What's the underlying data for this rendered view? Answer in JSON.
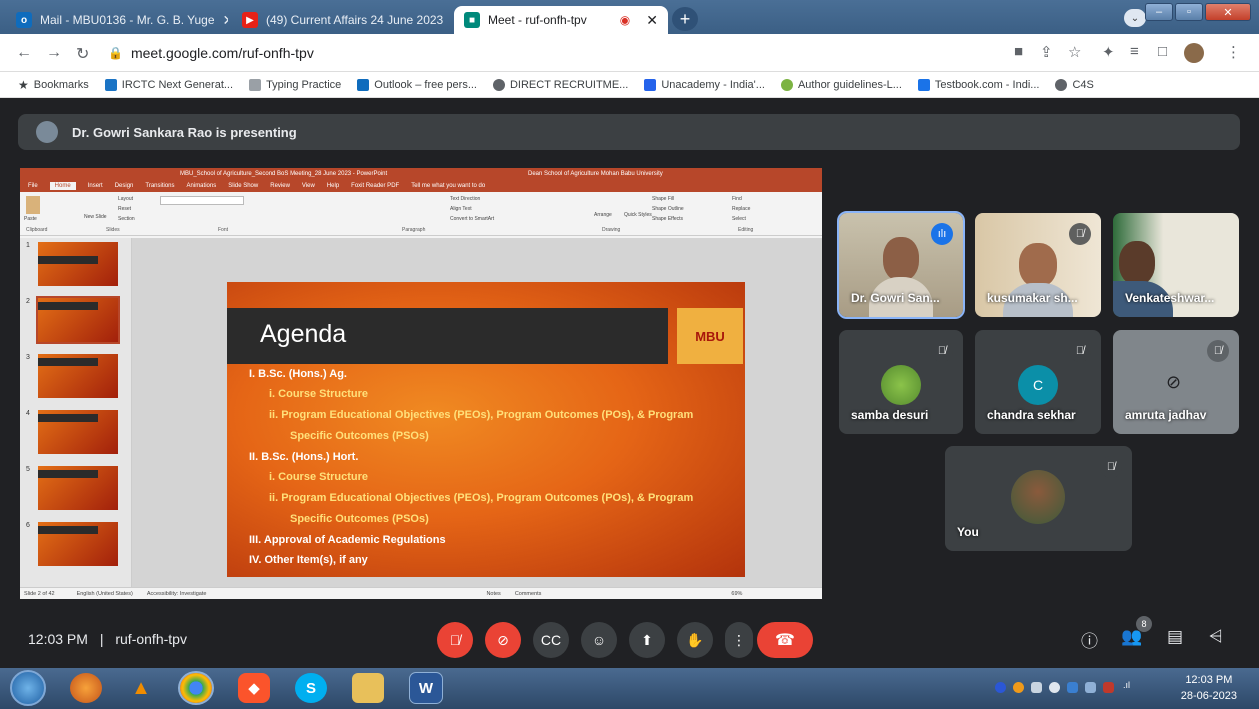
{
  "browser": {
    "tabs": [
      {
        "title": "Mail - MBU0136 - Mr. G. B. Yuge",
        "icon": "outlook-icon",
        "active": false
      },
      {
        "title": "(49) Current Affairs 24 June 2023",
        "icon": "youtube-icon",
        "active": false
      },
      {
        "title": "Meet - ruf-onfh-tpv",
        "icon": "meet-icon",
        "active": true
      }
    ],
    "new_tab_label": "+",
    "url": "meet.google.com/ruf-onfh-tpv",
    "bookmarks_label": "Bookmarks",
    "bookmarks": [
      "IRCTC Next Generat...",
      "Typing Practice",
      "Outlook – free pers...",
      "DIRECT RECRUITME...",
      "Unacademy - India'...",
      "Author guidelines-L...",
      "Testbook.com - Indi...",
      "C4S"
    ]
  },
  "meet": {
    "presenting_text": "Dr. Gowri Sankara Rao is presenting",
    "time": "12:03 PM",
    "separator": "|",
    "meeting_code": "ruf-onfh-tpv",
    "participant_count": "8",
    "participants": [
      {
        "name": "Dr. Gowri San...",
        "muted": false,
        "speaking": true
      },
      {
        "name": "kusumakar sh...",
        "muted": true
      },
      {
        "name": "Venkateshwar...",
        "muted": true
      },
      {
        "name": "samba desuri",
        "muted": true
      },
      {
        "name": "chandra sekhar",
        "muted": true,
        "initial": "C",
        "avatar_color": "#0b8fa8"
      },
      {
        "name": "amruta jadhav",
        "muted": true
      },
      {
        "name": "You",
        "muted": true
      }
    ]
  },
  "ppt": {
    "title_bar": "MBU_School of Agriculture_Second BoS Meeting_28 June 2023 - PowerPoint",
    "title_bar_right": "Dean School of Agriculture Mohan Babu University",
    "menu": [
      "File",
      "Home",
      "Insert",
      "Design",
      "Transitions",
      "Animations",
      "Slide Show",
      "Review",
      "View",
      "Help",
      "Foxit Reader PDF",
      "Tell me what you want to do"
    ],
    "groups": [
      "Clipboard",
      "Slides",
      "Font",
      "Paragraph",
      "Drawing",
      "Editing"
    ],
    "ribbon_items": {
      "paste": "Paste",
      "layout": "Layout",
      "reset": "Reset",
      "new_slide": "New Slide",
      "section": "Section",
      "text_direction": "Text Direction",
      "align_text": "Align Text",
      "convert_smartart": "Convert to SmartArt",
      "arrange": "Arrange",
      "quick_styles": "Quick Styles",
      "shape_fill": "Shape Fill",
      "shape_outline": "Shape Outline",
      "shape_effects": "Shape Effects",
      "find": "Find",
      "replace": "Replace",
      "select": "Select"
    },
    "status": "Slide 2 of 42",
    "language": "English (United States)",
    "accessibility": "Accessibility: Investigate",
    "notes": "Notes",
    "comments": "Comments",
    "zoom": "69%",
    "thumb_numbers": [
      "1",
      "2",
      "3",
      "4",
      "5",
      "6"
    ]
  },
  "slide": {
    "title": "Agenda",
    "logo_text": "MBU",
    "lines": [
      {
        "text": "I.    B.Sc. (Hons.) Ag.",
        "style": "w"
      },
      {
        "text": "i.   Course Structure",
        "style": "y"
      },
      {
        "text": "ii.  Program Educational Objectives (PEOs), Program Outcomes (POs), & Program",
        "style": "y"
      },
      {
        "text": "Specific Outcomes (PSOs)",
        "style": "y"
      },
      {
        "text": "II.   B.Sc. (Hons.) Hort.",
        "style": "w"
      },
      {
        "text": "i.   Course Structure",
        "style": "y"
      },
      {
        "text": "ii.  Program Educational Objectives (PEOs), Program Outcomes (POs), & Program",
        "style": "y"
      },
      {
        "text": "Specific Outcomes (PSOs)",
        "style": "y"
      },
      {
        "text": "III.  Approval of Academic Regulations",
        "style": "w"
      },
      {
        "text": "IV.  Other Item(s), if any",
        "style": "w"
      }
    ]
  },
  "taskbar": {
    "time": "12:03 PM",
    "date": "28-06-2023"
  }
}
